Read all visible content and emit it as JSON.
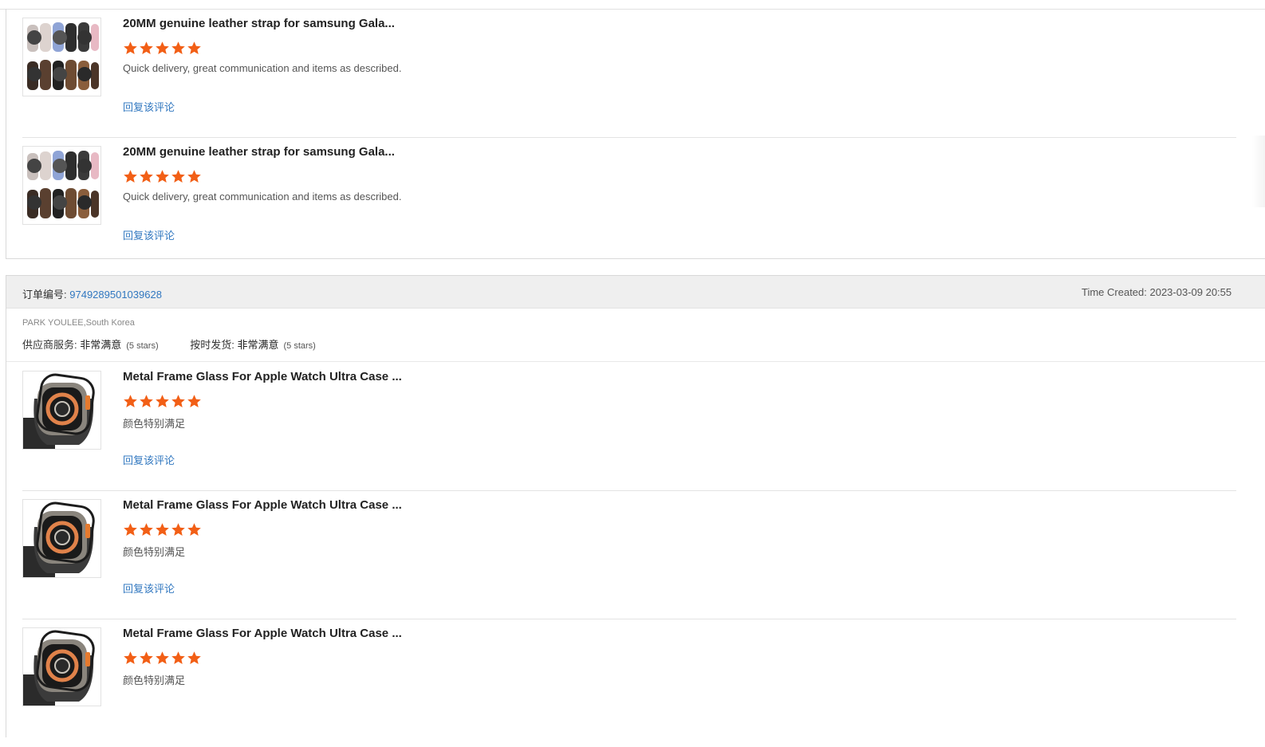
{
  "star_color": "#f25f16",
  "link_color": "#3278c0",
  "order_top": {
    "items": [
      {
        "title": "20MM genuine leather strap for samsung Gala...",
        "rating": 5,
        "comment": "Quick delivery, great communication and items as described.",
        "reply_label": "回复该评论",
        "thumb_icon": "watch-strap-icon"
      },
      {
        "title": "20MM genuine leather strap for samsung Gala...",
        "rating": 5,
        "comment": "Quick delivery, great communication and items as described.",
        "reply_label": "回复该评论",
        "thumb_icon": "watch-strap-icon"
      }
    ]
  },
  "order": {
    "number_label": "订单编号:",
    "number": "9749289501039628",
    "time_created": "Time Created: 2023-03-09 20:55",
    "buyer": "PARK YOULEE,South Korea",
    "supplier_service": {
      "label": "供应商服务:",
      "value": "非常满意",
      "stars_text": "(5 stars)"
    },
    "on_time_shipping": {
      "label": "按时发货:",
      "value": "非常满意",
      "stars_text": "(5 stars)"
    },
    "items": [
      {
        "title": "Metal Frame Glass For Apple Watch Ultra Case ...",
        "rating": 5,
        "comment": "颜色特别满足",
        "reply_label": "回复该评论",
        "thumb_icon": "apple-watch-ultra-icon"
      },
      {
        "title": "Metal Frame Glass For Apple Watch Ultra Case ...",
        "rating": 5,
        "comment": "颜色特别满足",
        "reply_label": "回复该评论",
        "thumb_icon": "apple-watch-ultra-icon"
      },
      {
        "title": "Metal Frame Glass For Apple Watch Ultra Case ...",
        "rating": 5,
        "comment": "颜色特别满足",
        "reply_label": "",
        "thumb_icon": "apple-watch-ultra-icon"
      }
    ]
  }
}
